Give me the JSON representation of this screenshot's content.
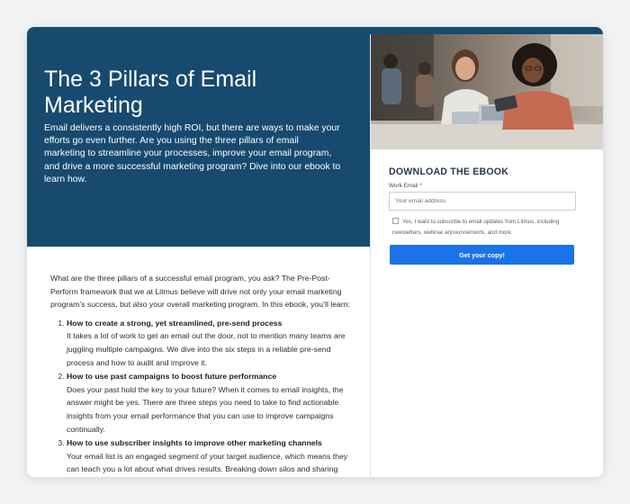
{
  "hero": {
    "title": "The 3 Pillars of Email Marketing",
    "description": "Email delivers a consistently high ROI, but there are ways to make your efforts go even further. Are you using the three pillars of email marketing to streamline your processes, improve your email program, and drive a more successful marketing program? Dive into our ebook to learn how."
  },
  "content": {
    "intro": "What are the three pillars of a successful email program, you ask? The Pre-Post-Perform framework that we at Litmus believe will drive not only your email marketing program’s success, but also your overall marketing program. In this ebook, you’ll learn:",
    "items": [
      {
        "title": "How to create a strong, yet streamlined, pre-send process",
        "text": "It takes a lot of work to get an email out the door, not to mention many teams are juggling multiple campaigns. We dive into the six steps in a reliable pre-send process and how to audit and improve it."
      },
      {
        "title": "How to use past campaigns to boost future performance",
        "text": "Does your past hold the key to your future? When it comes to email insights, the answer might be yes. There are three steps you need to take to find actionable insights from your email performance that you can use to improve campaigns continually."
      },
      {
        "title": "How to use subscriber insights to improve other marketing channels",
        "text": "Your email list is an engaged segment of your target audience, which means they can teach you a lot about what drives results. Breaking down silos and sharing insights across teams helps your company make informed marketing decisions."
      }
    ]
  },
  "form": {
    "title": "DOWNLOAD THE EBOOK",
    "email_label": "Work Email *",
    "email_placeholder": "Your email address",
    "email_value": "",
    "consent_text": "Yes, I want to subscribe to email updates from Litmus, including newsletters, webinar announcements, and more.",
    "consent_checked": false,
    "submit_label": "Get your copy!"
  },
  "colors": {
    "hero_bg": "#174a6e",
    "button_bg": "#1a73e8",
    "page_bg": "#f1f2f4"
  }
}
